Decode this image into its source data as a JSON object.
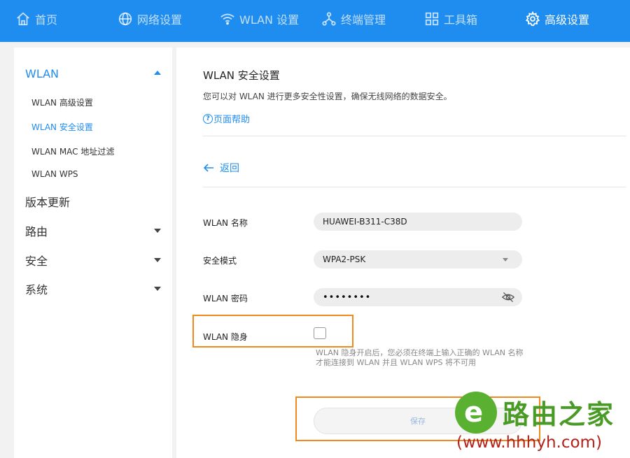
{
  "topnav": {
    "items": [
      {
        "label": "首页",
        "icon": "home-icon"
      },
      {
        "label": "网络设置",
        "icon": "globe-icon"
      },
      {
        "label": "WLAN 设置",
        "icon": "wifi-icon"
      },
      {
        "label": "终端管理",
        "icon": "network-icon"
      },
      {
        "label": "工具箱",
        "icon": "grid-icon"
      },
      {
        "label": "高级设置",
        "icon": "gear-icon",
        "active": true
      }
    ]
  },
  "sidebar": {
    "wlan": {
      "label": "WLAN",
      "expanded": true
    },
    "wlan_items": [
      {
        "label": "WLAN 高级设置"
      },
      {
        "label": "WLAN 安全设置",
        "active": true
      },
      {
        "label": "WLAN MAC 地址过滤"
      },
      {
        "label": "WLAN WPS"
      }
    ],
    "update": {
      "label": "版本更新"
    },
    "routing": {
      "label": "路由"
    },
    "security": {
      "label": "安全"
    },
    "system": {
      "label": "系统"
    }
  },
  "main": {
    "title": "WLAN 安全设置",
    "description": "您可以对 WLAN 进行更多安全性设置，确保无线网络的数据安全。",
    "help_label": "页面帮助",
    "back_label": "返回",
    "form": {
      "ssid_label": "WLAN 名称",
      "ssid_value": "HUAWEI-B311-C38D",
      "mode_label": "安全模式",
      "mode_value": "WPA2-PSK",
      "password_label": "WLAN 密码",
      "password_value": "••••••••",
      "hidden_label": "WLAN 隐身",
      "hidden_checked": false,
      "hidden_hint": "WLAN 隐身开启后，您必须在终端上输入正确的 WLAN 名称才能连接到 WLAN 并且 WLAN WPS 将不可用"
    },
    "save_label": "保存"
  },
  "watermark": {
    "logo_letter": "e",
    "title": "路由之家",
    "url": "(www.hhhyh.com)"
  },
  "colors": {
    "brand": "#1f8cf0",
    "highlight": "#f08a1c",
    "watermark_green": "#4a9b26",
    "watermark_red": "#b3221a"
  }
}
